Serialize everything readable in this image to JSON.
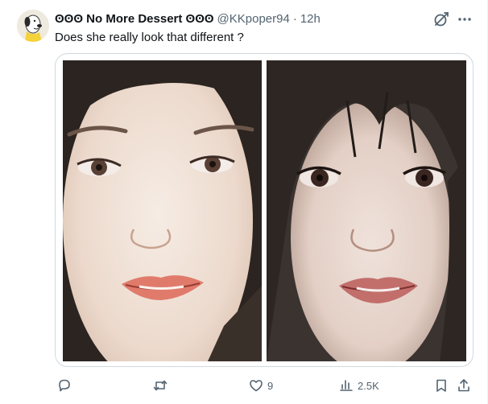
{
  "post": {
    "author_name": "ʘʘʘ No More Dessert ʘʘʘ",
    "handle": "@KKpoper94",
    "separator": "·",
    "time": "12h",
    "text": "Does she really look that different ?"
  },
  "media": {
    "left_photo": "portrait-photo-left",
    "right_photo": "portrait-photo-right"
  },
  "actions": {
    "reply_count": "",
    "repost_count": "",
    "like_count": "9",
    "views_count": "2.5K"
  },
  "colors": {
    "text": "#0f1419",
    "secondary": "#536471",
    "border": "#cfd9de"
  },
  "icons": [
    "avatar",
    "grok-icon",
    "more-icon",
    "reply-icon",
    "repost-icon",
    "like-icon",
    "views-icon",
    "bookmark-icon",
    "share-icon"
  ]
}
